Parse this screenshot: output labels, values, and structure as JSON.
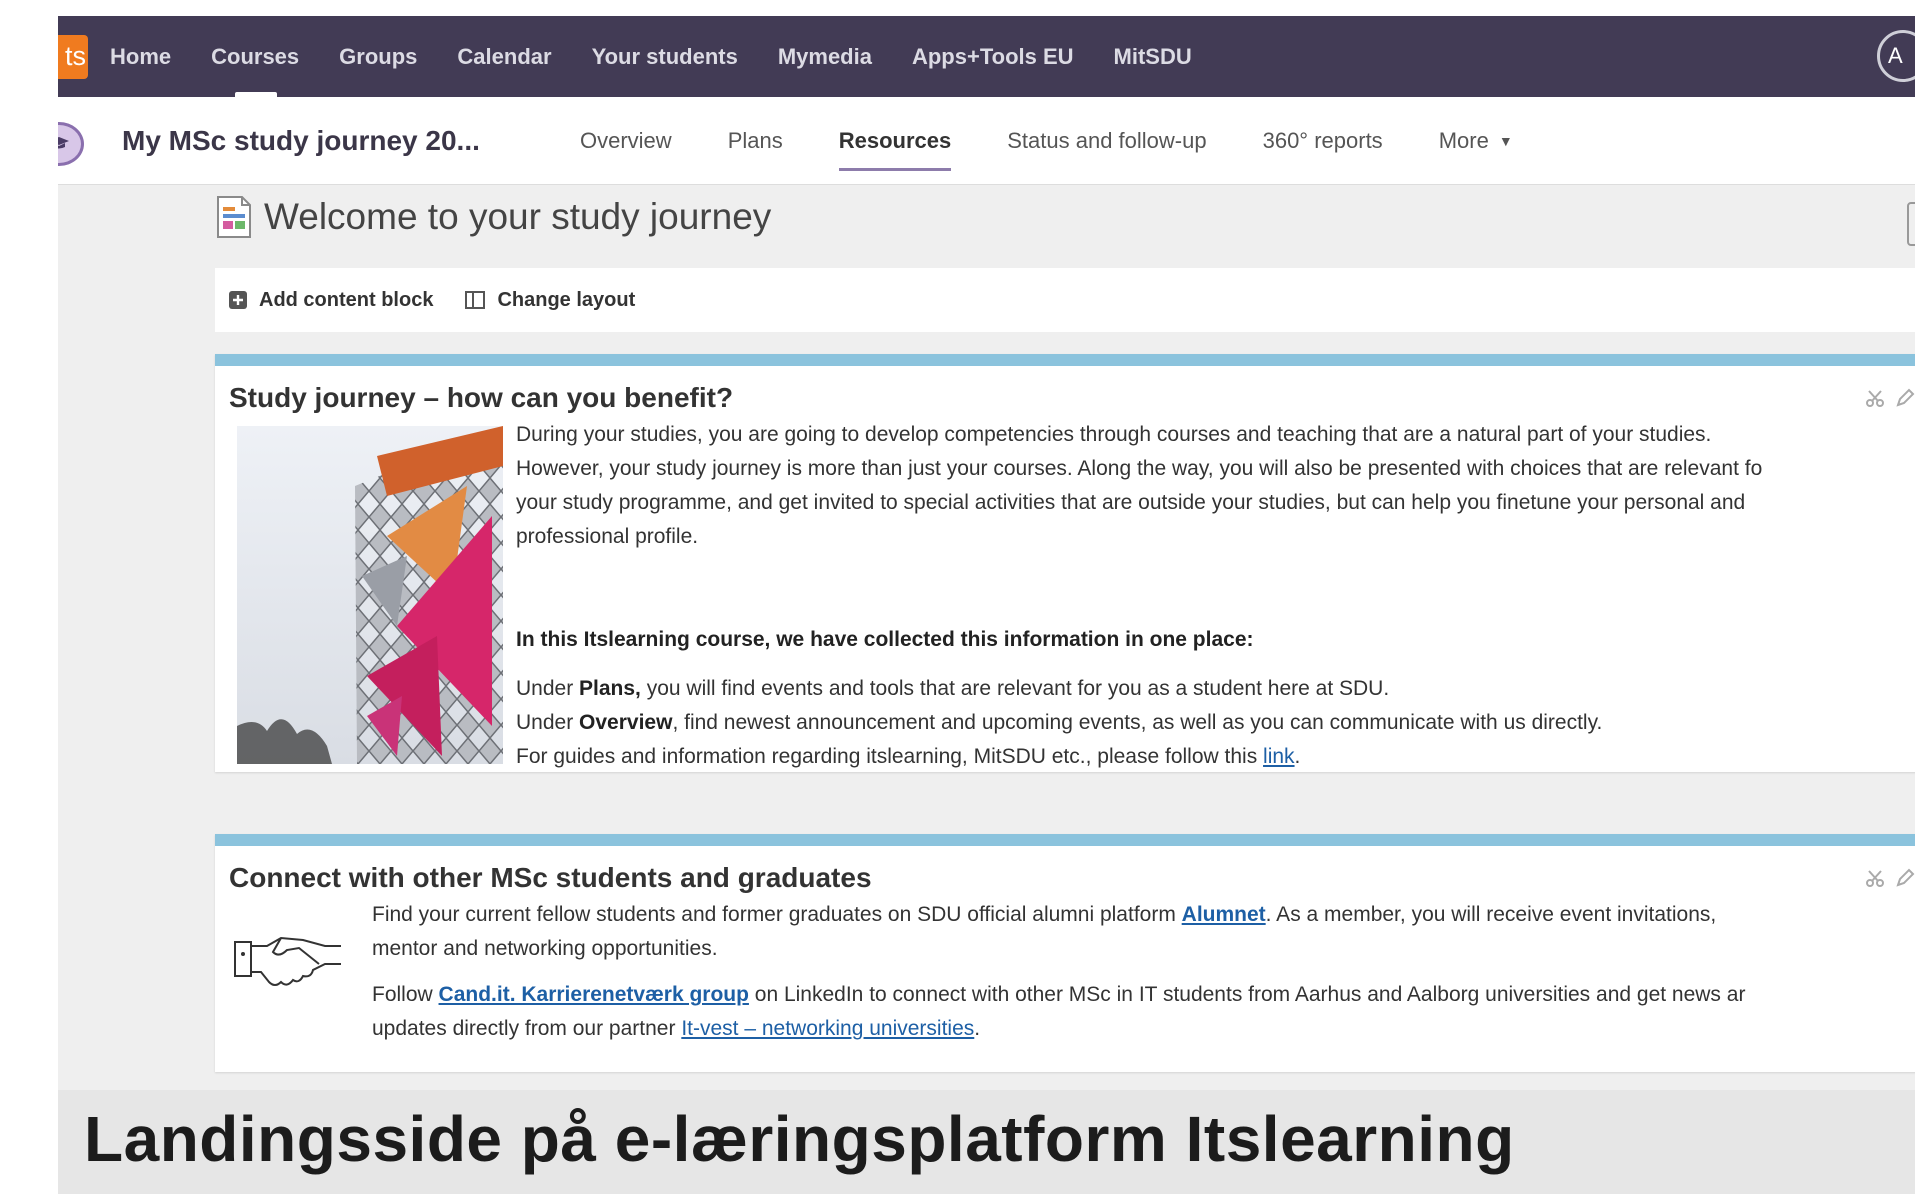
{
  "logo": {
    "text": "ts",
    "color": "#f07b1f"
  },
  "topnav": {
    "items": [
      "Home",
      "Courses",
      "Groups",
      "Calendar",
      "Your students",
      "Mymedia",
      "Apps+Tools EU",
      "MitSDU"
    ],
    "profile_initial": "A",
    "background": "#423b55"
  },
  "course": {
    "title": "My MSc study journey 20...",
    "tabs": [
      "Overview",
      "Plans",
      "Resources",
      "Status and follow-up",
      "360° reports",
      "More"
    ],
    "active_tab": "Resources"
  },
  "page": {
    "heading": "Welcome to your study journey"
  },
  "toolbar": {
    "add_block_label": "Add content block",
    "change_layout_label": "Change layout"
  },
  "block1": {
    "title": "Study journey – how can you benefit?",
    "lines": [
      "During your studies, you are going to develop competencies through courses and teaching that are a natural part of your studies.",
      "However, your study journey is more than just your courses. Along the way, you will also be presented with choices that are relevant fo",
      "your study programme, and get invited to special activities that are outside your studies, but can help you finetune your personal and",
      "professional profile."
    ],
    "heading": "In this Itslearning course, we have collected this information in one place:",
    "plans_pre": "Under ",
    "plans_bold": "Plans,",
    "plans_post": " you will find events and tools that are relevant for you as a student here at SDU.",
    "overview_pre": "Under ",
    "overview_bold": "Overview",
    "overview_post": ", find newest announcement and upcoming events, as well as you can communicate with us directly.",
    "guides_pre": "For guides and information regarding itslearning, MitSDU etc., please follow this ",
    "guides_link": "link",
    "guides_post": "."
  },
  "block2": {
    "title": "Connect with other MSc students and graduates",
    "p1_pre": "Find your current fellow students and former graduates on SDU official alumni platform ",
    "p1_link": "Alumnet",
    "p1_post": ". As a member, you will receive event invitations,",
    "p1_line2": "mentor and networking opportunities.",
    "p2_pre": "Follow ",
    "p2_link": "Cand.it. Karrierenetværk group",
    "p2_post": " on LinkedIn to connect with other MSc in IT students from Aarhus and Aalborg universities and get news ar",
    "p2_line2_pre": "updates directly from our partner ",
    "p2_line2_link": "It-vest – networking universities",
    "p2_line2_post": "."
  },
  "caption": {
    "text": "Landingsside på e-læringsplatform Itslearning"
  },
  "colors": {
    "accent_bar": "#8bc3dd",
    "link": "#1d5fa5",
    "tab_underline": "#8d7cab"
  }
}
